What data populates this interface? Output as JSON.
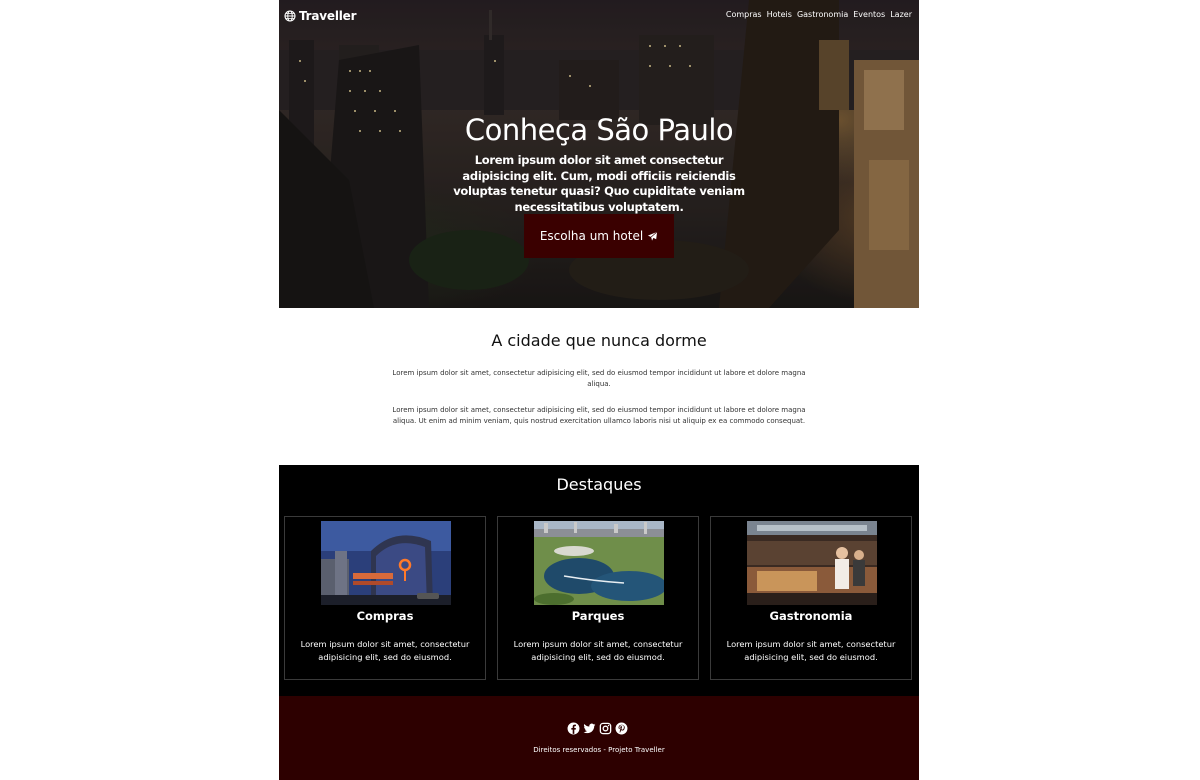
{
  "header": {
    "brand": "Traveller",
    "nav": [
      "Compras",
      "Hoteis",
      "Gastronomia",
      "Eventos",
      "Lazer"
    ]
  },
  "hero": {
    "title": "Conheça São Paulo",
    "subtitle": "Lorem ipsum dolor sit amet consectetur adipisicing elit. Cum, modi officiis reiciendis voluptas tenetur quasi? Quo cupiditate veniam necessitatibus voluptatem.",
    "cta_label": "Escolha um hotel",
    "cta_icon": "paper-plane-icon"
  },
  "about": {
    "title": "A cidade que nunca dorme",
    "paragraphs": [
      "Lorem ipsum dolor sit amet, consectetur adipisicing elit, sed do eiusmod tempor incididunt ut labore et dolore magna aliqua.",
      "Lorem ipsum dolor sit amet, consectetur adipisicing elit, sed do eiusmod tempor incididunt ut labore et dolore magna aliqua. Ut enim ad minim veniam, quis nostrud exercitation ullamco laboris nisi ut aliquip ex ea commodo consequat."
    ]
  },
  "highlights": {
    "title": "Destaques",
    "cards": [
      {
        "title": "Compras",
        "text": "Lorem ipsum dolor sit amet, consectetur adipisicing elit, sed do eiusmod.",
        "image": "shopping-mall-photo"
      },
      {
        "title": "Parques",
        "text": "Lorem ipsum dolor sit amet, consectetur adipisicing elit, sed do eiusmod.",
        "image": "park-lake-photo"
      },
      {
        "title": "Gastronomia",
        "text": "Lorem ipsum dolor sit amet, consectetur adipisicing elit, sed do eiusmod.",
        "image": "restaurant-kitchen-photo"
      }
    ]
  },
  "footer": {
    "social": [
      "facebook-icon",
      "twitter-icon",
      "instagram-icon",
      "pinterest-icon"
    ],
    "copyright": "Direitos reservados - Projeto Traveller"
  },
  "colors": {
    "cta_bg": "#3a0000",
    "highlights_bg": "#000000",
    "footer_bg": "#2d0000"
  }
}
